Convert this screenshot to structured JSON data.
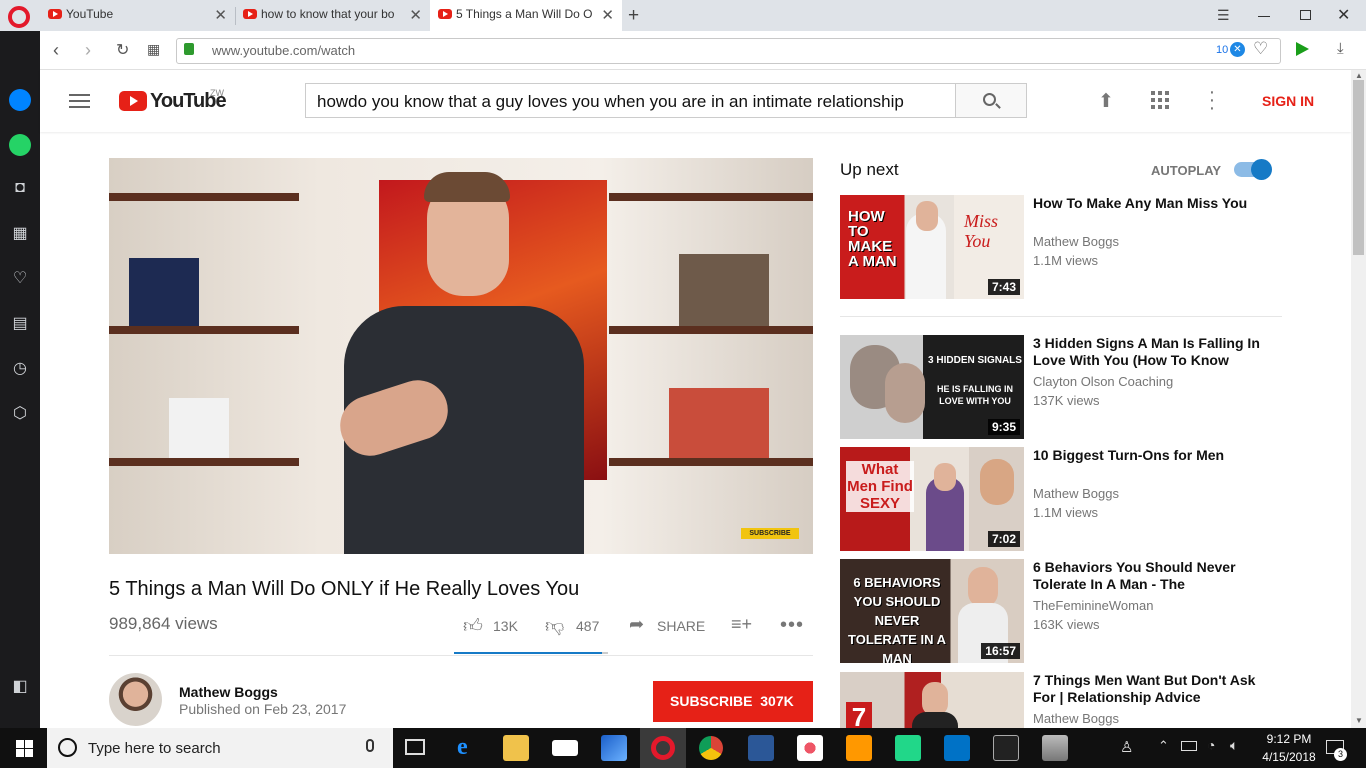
{
  "browser": {
    "tabs": [
      {
        "title": "YouTube",
        "active": false
      },
      {
        "title": "how to know that your bo",
        "active": false
      },
      {
        "title": "5 Things a Man Will Do O",
        "active": true
      }
    ],
    "url": "www.youtube.com/watch",
    "ad_block_count": "10"
  },
  "youtube": {
    "logo_text": "YouTube",
    "region": "ZW",
    "search_query": "howdo you know that a guy loves you when you are in an intimate relationship",
    "sign_in": "SIGN IN"
  },
  "video": {
    "title": "5 Things a Man Will Do ONLY if He Really Loves You",
    "views": "989,864 views",
    "likes": "13K",
    "dislikes": "487",
    "share_label": "SHARE",
    "like_ratio": 0.964,
    "overlay_label": "SUBSCRIBE",
    "channel": "Mathew Boggs",
    "published": "Published on Feb 23, 2017",
    "subscribe_label": "SUBSCRIBE",
    "subscriber_count": "307K"
  },
  "up_next": {
    "label": "Up next",
    "autoplay_label": "AUTOPLAY",
    "autoplay_on": true,
    "items": [
      {
        "title": "How To Make Any Man Miss You",
        "channel": "Mathew Boggs",
        "views": "1.1M views",
        "duration": "7:43",
        "thumb_text": "HOW TO MAKE A MAN",
        "thumb_text2": "Miss You"
      },
      {
        "title": "3 Hidden Signs A Man Is Falling In Love With You (How To Know",
        "channel": "Clayton Olson Coaching",
        "views": "137K views",
        "duration": "9:35",
        "thumb_text": "3 HIDDEN SIGNALS",
        "thumb_text2": "HE IS FALLING IN LOVE WITH YOU"
      },
      {
        "title": "10 Biggest Turn-Ons for Men",
        "channel": "Mathew Boggs",
        "views": "1.1M views",
        "duration": "7:02",
        "thumb_text": "What Men Find SEXY",
        "thumb_text2": ""
      },
      {
        "title": "6 Behaviors You Should Never Tolerate In A Man - The",
        "channel": "TheFeminineWoman",
        "views": "163K views",
        "duration": "16:57",
        "thumb_text": "6 BEHAVIORS YOU SHOULD NEVER TOLERATE IN A MAN",
        "thumb_text2": ""
      },
      {
        "title": "7 Things Men Want But Don't Ask For | Relationship Advice",
        "channel": "Mathew Boggs",
        "views": "",
        "duration": "",
        "thumb_text": "7",
        "thumb_text2": ""
      }
    ]
  },
  "taskbar": {
    "search_placeholder": "Type here to search",
    "time": "9:12 PM",
    "date": "4/15/2018",
    "notifications": "3"
  },
  "colors": {
    "youtube_red": "#e62117",
    "autoplay_blue": "#167ac6",
    "opera_red": "#e3192b"
  }
}
